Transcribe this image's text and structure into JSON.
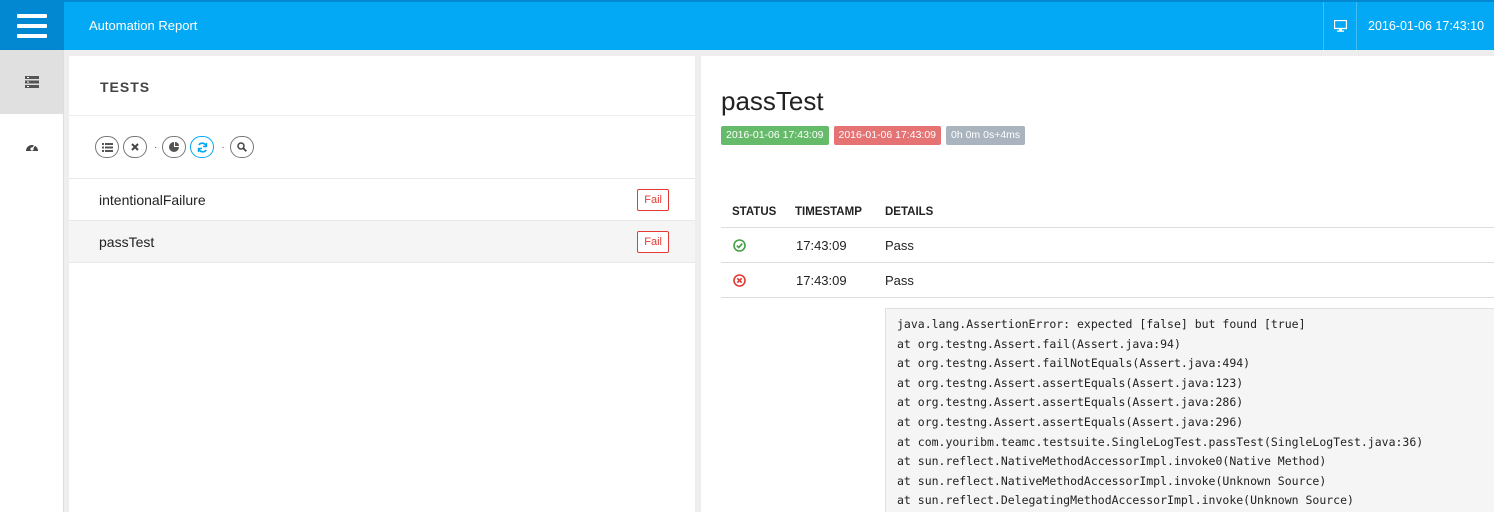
{
  "header": {
    "title": "Automation Report",
    "datetime": "2016-01-06 17:43:10",
    "accent": "#03a9f4"
  },
  "sidenav": {
    "items": [
      {
        "icon": "list-icon",
        "active": true
      },
      {
        "icon": "dashboard-icon",
        "active": false
      }
    ]
  },
  "tests_panel": {
    "title": "TESTS",
    "filters": [
      "list-icon",
      "close-icon",
      "pie-chart-icon",
      "refresh-icon",
      "search-icon"
    ],
    "tests": [
      {
        "name": "intentionalFailure",
        "status": "Fail"
      },
      {
        "name": "passTest",
        "status": "Fail"
      }
    ]
  },
  "detail": {
    "title": "passTest",
    "start_time": "2016-01-06 17:43:09",
    "end_time": "2016-01-06 17:43:09",
    "duration": "0h 0m 0s+4ms",
    "columns": [
      "STATUS",
      "TIMESTAMP",
      "DETAILS"
    ],
    "logs": [
      {
        "status": "pass",
        "timestamp": "17:43:09",
        "details": "Pass"
      },
      {
        "status": "fail",
        "timestamp": "17:43:09",
        "details": "Pass"
      }
    ],
    "stack_trace": [
      "java.lang.AssertionError: expected [false] but found [true]",
      "at org.testng.Assert.fail(Assert.java:94)",
      "at org.testng.Assert.failNotEquals(Assert.java:494)",
      "at org.testng.Assert.assertEquals(Assert.java:123)",
      "at org.testng.Assert.assertEquals(Assert.java:286)",
      "at org.testng.Assert.assertEquals(Assert.java:296)",
      "at com.youribm.teamc.testsuite.SingleLogTest.passTest(SingleLogTest.java:36)",
      "at sun.reflect.NativeMethodAccessorImpl.invoke0(Native Method)",
      "at sun.reflect.NativeMethodAccessorImpl.invoke(Unknown Source)",
      "at sun.reflect.DelegatingMethodAccessorImpl.invoke(Unknown Source)"
    ]
  }
}
